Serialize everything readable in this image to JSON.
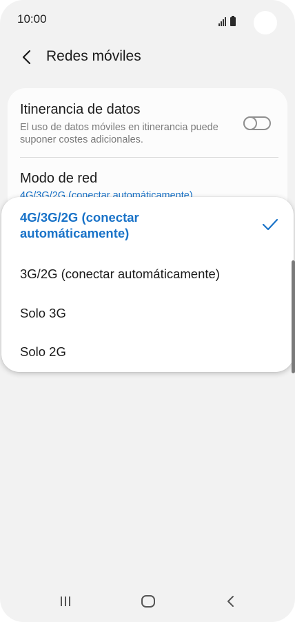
{
  "status_bar": {
    "time": "10:00"
  },
  "header": {
    "title": "Redes móviles"
  },
  "settings": {
    "roaming": {
      "title": "Itinerancia de datos",
      "description": "El uso de datos móviles en itinerancia puede suponer costes adicionales.",
      "enabled": false
    },
    "network_mode": {
      "title": "Modo de red",
      "value": "4G/3G/2G (conectar automáticamente)"
    }
  },
  "network_mode_options": [
    {
      "label": "4G/3G/2G (conectar automáticamente)",
      "selected": true
    },
    {
      "label": "3G/2G (conectar automáticamente)",
      "selected": false
    },
    {
      "label": "Solo 3G",
      "selected": false
    },
    {
      "label": "Solo 2G",
      "selected": false
    }
  ],
  "colors": {
    "accent": "#1a73c8",
    "background": "#f2f2f2",
    "card": "#fcfcfc"
  },
  "icons": {
    "back": "back-arrow-icon",
    "check": "checkmark-icon",
    "nav_recent": "recent-apps-icon",
    "nav_home": "home-icon",
    "nav_back": "nav-back-icon"
  }
}
